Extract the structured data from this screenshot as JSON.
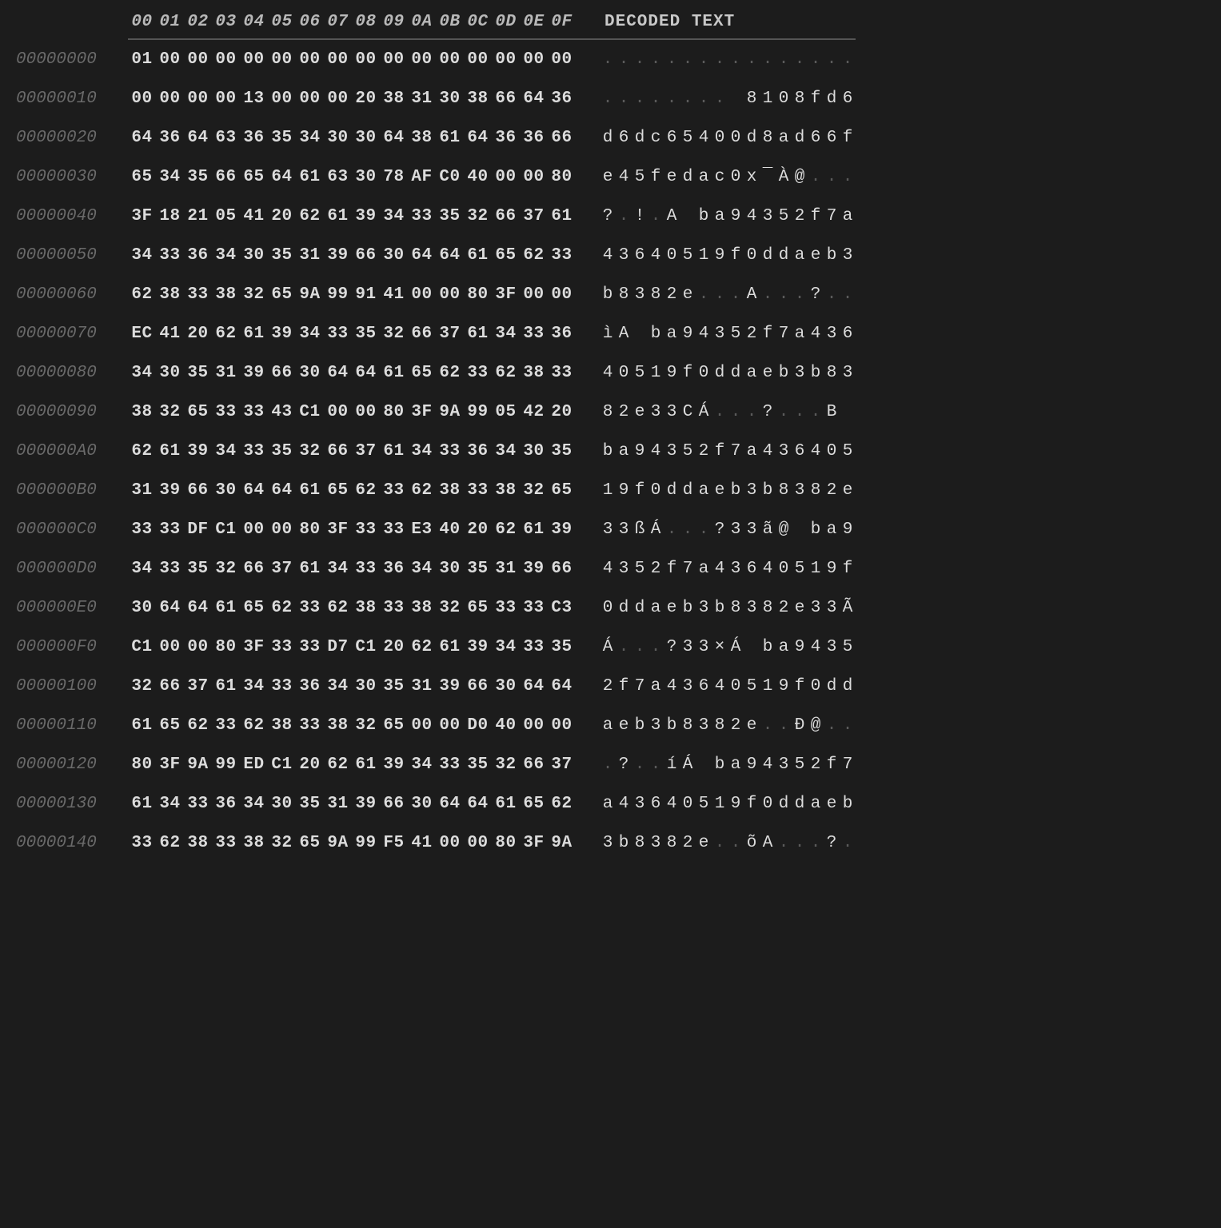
{
  "header": {
    "hex_cols": [
      "00",
      "01",
      "02",
      "03",
      "04",
      "05",
      "06",
      "07",
      "08",
      "09",
      "0A",
      "0B",
      "0C",
      "0D",
      "0E",
      "0F"
    ],
    "decoded_label": "DECODED TEXT"
  },
  "rows": [
    {
      "offset": "00000000",
      "hex": [
        "01",
        "00",
        "00",
        "00",
        "00",
        "00",
        "00",
        "00",
        "00",
        "00",
        "00",
        "00",
        "00",
        "00",
        "00",
        "00"
      ],
      "dec": [
        ".",
        ".",
        ".",
        ".",
        ".",
        ".",
        ".",
        ".",
        ".",
        ".",
        ".",
        ".",
        ".",
        ".",
        ".",
        "."
      ]
    },
    {
      "offset": "00000010",
      "hex": [
        "00",
        "00",
        "00",
        "00",
        "13",
        "00",
        "00",
        "00",
        "20",
        "38",
        "31",
        "30",
        "38",
        "66",
        "64",
        "36"
      ],
      "dec": [
        ".",
        ".",
        ".",
        ".",
        ".",
        ".",
        ".",
        ".",
        " ",
        "8",
        "1",
        "0",
        "8",
        "f",
        "d",
        "6"
      ]
    },
    {
      "offset": "00000020",
      "hex": [
        "64",
        "36",
        "64",
        "63",
        "36",
        "35",
        "34",
        "30",
        "30",
        "64",
        "38",
        "61",
        "64",
        "36",
        "36",
        "66"
      ],
      "dec": [
        "d",
        "6",
        "d",
        "c",
        "6",
        "5",
        "4",
        "0",
        "0",
        "d",
        "8",
        "a",
        "d",
        "6",
        "6",
        "f"
      ]
    },
    {
      "offset": "00000030",
      "hex": [
        "65",
        "34",
        "35",
        "66",
        "65",
        "64",
        "61",
        "63",
        "30",
        "78",
        "AF",
        "C0",
        "40",
        "00",
        "00",
        "80"
      ],
      "dec": [
        "e",
        "4",
        "5",
        "f",
        "e",
        "d",
        "a",
        "c",
        "0",
        "x",
        "¯",
        "À",
        "@",
        ".",
        ".",
        "."
      ]
    },
    {
      "offset": "00000040",
      "hex": [
        "3F",
        "18",
        "21",
        "05",
        "41",
        "20",
        "62",
        "61",
        "39",
        "34",
        "33",
        "35",
        "32",
        "66",
        "37",
        "61"
      ],
      "dec": [
        "?",
        ".",
        "!",
        ".",
        "A",
        " ",
        "b",
        "a",
        "9",
        "4",
        "3",
        "5",
        "2",
        "f",
        "7",
        "a"
      ]
    },
    {
      "offset": "00000050",
      "hex": [
        "34",
        "33",
        "36",
        "34",
        "30",
        "35",
        "31",
        "39",
        "66",
        "30",
        "64",
        "64",
        "61",
        "65",
        "62",
        "33"
      ],
      "dec": [
        "4",
        "3",
        "6",
        "4",
        "0",
        "5",
        "1",
        "9",
        "f",
        "0",
        "d",
        "d",
        "a",
        "e",
        "b",
        "3"
      ]
    },
    {
      "offset": "00000060",
      "hex": [
        "62",
        "38",
        "33",
        "38",
        "32",
        "65",
        "9A",
        "99",
        "91",
        "41",
        "00",
        "00",
        "80",
        "3F",
        "00",
        "00"
      ],
      "dec": [
        "b",
        "8",
        "3",
        "8",
        "2",
        "e",
        ".",
        ".",
        ".",
        "A",
        ".",
        ".",
        ".",
        "?",
        ".",
        "."
      ]
    },
    {
      "offset": "00000070",
      "hex": [
        "EC",
        "41",
        "20",
        "62",
        "61",
        "39",
        "34",
        "33",
        "35",
        "32",
        "66",
        "37",
        "61",
        "34",
        "33",
        "36"
      ],
      "dec": [
        "ì",
        "A",
        " ",
        "b",
        "a",
        "9",
        "4",
        "3",
        "5",
        "2",
        "f",
        "7",
        "a",
        "4",
        "3",
        "6"
      ]
    },
    {
      "offset": "00000080",
      "hex": [
        "34",
        "30",
        "35",
        "31",
        "39",
        "66",
        "30",
        "64",
        "64",
        "61",
        "65",
        "62",
        "33",
        "62",
        "38",
        "33"
      ],
      "dec": [
        "4",
        "0",
        "5",
        "1",
        "9",
        "f",
        "0",
        "d",
        "d",
        "a",
        "e",
        "b",
        "3",
        "b",
        "8",
        "3"
      ]
    },
    {
      "offset": "00000090",
      "hex": [
        "38",
        "32",
        "65",
        "33",
        "33",
        "43",
        "C1",
        "00",
        "00",
        "80",
        "3F",
        "9A",
        "99",
        "05",
        "42",
        "20"
      ],
      "dec": [
        "8",
        "2",
        "e",
        "3",
        "3",
        "C",
        "Á",
        ".",
        ".",
        ".",
        "?",
        ".",
        ".",
        ".",
        "B",
        " "
      ]
    },
    {
      "offset": "000000A0",
      "hex": [
        "62",
        "61",
        "39",
        "34",
        "33",
        "35",
        "32",
        "66",
        "37",
        "61",
        "34",
        "33",
        "36",
        "34",
        "30",
        "35"
      ],
      "dec": [
        "b",
        "a",
        "9",
        "4",
        "3",
        "5",
        "2",
        "f",
        "7",
        "a",
        "4",
        "3",
        "6",
        "4",
        "0",
        "5"
      ]
    },
    {
      "offset": "000000B0",
      "hex": [
        "31",
        "39",
        "66",
        "30",
        "64",
        "64",
        "61",
        "65",
        "62",
        "33",
        "62",
        "38",
        "33",
        "38",
        "32",
        "65"
      ],
      "dec": [
        "1",
        "9",
        "f",
        "0",
        "d",
        "d",
        "a",
        "e",
        "b",
        "3",
        "b",
        "8",
        "3",
        "8",
        "2",
        "e"
      ]
    },
    {
      "offset": "000000C0",
      "hex": [
        "33",
        "33",
        "DF",
        "C1",
        "00",
        "00",
        "80",
        "3F",
        "33",
        "33",
        "E3",
        "40",
        "20",
        "62",
        "61",
        "39"
      ],
      "dec": [
        "3",
        "3",
        "ß",
        "Á",
        ".",
        ".",
        ".",
        "?",
        "3",
        "3",
        "ã",
        "@",
        " ",
        "b",
        "a",
        "9"
      ]
    },
    {
      "offset": "000000D0",
      "hex": [
        "34",
        "33",
        "35",
        "32",
        "66",
        "37",
        "61",
        "34",
        "33",
        "36",
        "34",
        "30",
        "35",
        "31",
        "39",
        "66"
      ],
      "dec": [
        "4",
        "3",
        "5",
        "2",
        "f",
        "7",
        "a",
        "4",
        "3",
        "6",
        "4",
        "0",
        "5",
        "1",
        "9",
        "f"
      ]
    },
    {
      "offset": "000000E0",
      "hex": [
        "30",
        "64",
        "64",
        "61",
        "65",
        "62",
        "33",
        "62",
        "38",
        "33",
        "38",
        "32",
        "65",
        "33",
        "33",
        "C3"
      ],
      "dec": [
        "0",
        "d",
        "d",
        "a",
        "e",
        "b",
        "3",
        "b",
        "8",
        "3",
        "8",
        "2",
        "e",
        "3",
        "3",
        "Ã"
      ]
    },
    {
      "offset": "000000F0",
      "hex": [
        "C1",
        "00",
        "00",
        "80",
        "3F",
        "33",
        "33",
        "D7",
        "C1",
        "20",
        "62",
        "61",
        "39",
        "34",
        "33",
        "35"
      ],
      "dec": [
        "Á",
        ".",
        ".",
        ".",
        "?",
        "3",
        "3",
        "×",
        "Á",
        " ",
        "b",
        "a",
        "9",
        "4",
        "3",
        "5"
      ]
    },
    {
      "offset": "00000100",
      "hex": [
        "32",
        "66",
        "37",
        "61",
        "34",
        "33",
        "36",
        "34",
        "30",
        "35",
        "31",
        "39",
        "66",
        "30",
        "64",
        "64"
      ],
      "dec": [
        "2",
        "f",
        "7",
        "a",
        "4",
        "3",
        "6",
        "4",
        "0",
        "5",
        "1",
        "9",
        "f",
        "0",
        "d",
        "d"
      ]
    },
    {
      "offset": "00000110",
      "hex": [
        "61",
        "65",
        "62",
        "33",
        "62",
        "38",
        "33",
        "38",
        "32",
        "65",
        "00",
        "00",
        "D0",
        "40",
        "00",
        "00"
      ],
      "dec": [
        "a",
        "e",
        "b",
        "3",
        "b",
        "8",
        "3",
        "8",
        "2",
        "e",
        ".",
        ".",
        "Ð",
        "@",
        ".",
        "."
      ]
    },
    {
      "offset": "00000120",
      "hex": [
        "80",
        "3F",
        "9A",
        "99",
        "ED",
        "C1",
        "20",
        "62",
        "61",
        "39",
        "34",
        "33",
        "35",
        "32",
        "66",
        "37"
      ],
      "dec": [
        ".",
        "?",
        ".",
        ".",
        "í",
        "Á",
        " ",
        "b",
        "a",
        "9",
        "4",
        "3",
        "5",
        "2",
        "f",
        "7"
      ]
    },
    {
      "offset": "00000130",
      "hex": [
        "61",
        "34",
        "33",
        "36",
        "34",
        "30",
        "35",
        "31",
        "39",
        "66",
        "30",
        "64",
        "64",
        "61",
        "65",
        "62"
      ],
      "dec": [
        "a",
        "4",
        "3",
        "6",
        "4",
        "0",
        "5",
        "1",
        "9",
        "f",
        "0",
        "d",
        "d",
        "a",
        "e",
        "b"
      ]
    },
    {
      "offset": "00000140",
      "hex": [
        "33",
        "62",
        "38",
        "33",
        "38",
        "32",
        "65",
        "9A",
        "99",
        "F5",
        "41",
        "00",
        "00",
        "80",
        "3F",
        "9A"
      ],
      "dec": [
        "3",
        "b",
        "8",
        "3",
        "8",
        "2",
        "e",
        ".",
        ".",
        "õ",
        "A",
        ".",
        ".",
        ".",
        "?",
        "."
      ]
    }
  ]
}
